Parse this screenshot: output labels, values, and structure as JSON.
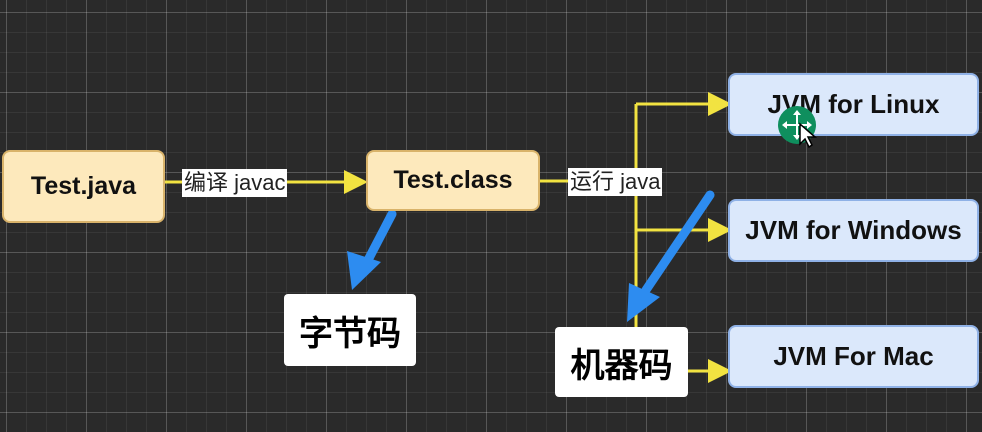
{
  "nodes": {
    "source_file": "Test.java",
    "class_file": "Test.class",
    "jvm_linux": "JVM for Linux",
    "jvm_windows": "JVM for Windows",
    "jvm_mac": "JVM For Mac"
  },
  "edge_labels": {
    "compile": "编译 javac",
    "run": "运行 java"
  },
  "callouts": {
    "bytecode": "字节码",
    "machine_code": "机器码"
  },
  "colors": {
    "connector": "#f2e341",
    "callout_arrow": "#2d8cf0",
    "source_fill": "#fde9bc",
    "jvm_fill": "#dbe8fb",
    "cursor_dot": "#0f8f5e"
  },
  "icons": {
    "cursor": "move-cursor-icon"
  }
}
